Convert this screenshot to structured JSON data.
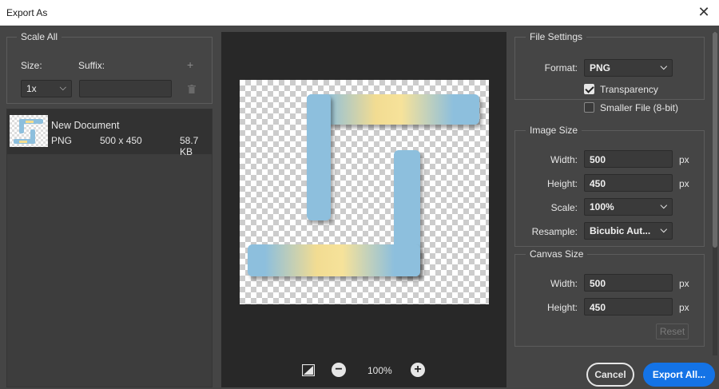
{
  "window": {
    "title": "Export As",
    "close_glyph": "✕"
  },
  "scale_all": {
    "title": "Scale All",
    "size_label": "Size:",
    "suffix_label": "Suffix:",
    "size_value": "1x",
    "suffix_value": "",
    "add_glyph": "+"
  },
  "asset": {
    "name": "New Document",
    "format": "PNG",
    "dimensions": "500 x 450",
    "file_size": "58.7 KB"
  },
  "preview": {
    "zoom": "100%",
    "colors": {
      "bar": "#8dbfdd",
      "glow": "#f4dc8e",
      "background": "#282828"
    }
  },
  "file_settings": {
    "title": "File Settings",
    "format_label": "Format:",
    "format_value": "PNG",
    "transparency_label": "Transparency",
    "transparency_checked": true,
    "smaller_file_label": "Smaller File (8-bit)",
    "smaller_file_checked": false
  },
  "image_size": {
    "title": "Image Size",
    "width_label": "Width:",
    "width_value": "500",
    "height_label": "Height:",
    "height_value": "450",
    "scale_label": "Scale:",
    "scale_value": "100%",
    "resample_label": "Resample:",
    "resample_value": "Bicubic Aut...",
    "unit": "px"
  },
  "canvas_size": {
    "title": "Canvas Size",
    "width_label": "Width:",
    "width_value": "500",
    "height_label": "Height:",
    "height_value": "450",
    "unit": "px",
    "reset_label": "Reset"
  },
  "buttons": {
    "cancel": "Cancel",
    "export": "Export All..."
  },
  "accent_color": "#1473e6"
}
